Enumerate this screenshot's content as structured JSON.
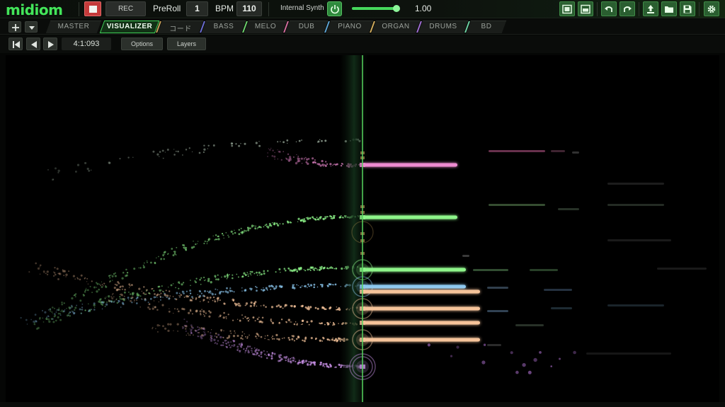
{
  "app": {
    "logo": "midiom"
  },
  "toolbar": {
    "rec_label": "REC",
    "preroll_label": "PreRoll",
    "preroll_value": "1",
    "bpm_label": "BPM",
    "bpm_value": "110",
    "synth_label": "Internal Synth",
    "volume_value": "1.00",
    "volume_level": 0.93
  },
  "tabs": [
    {
      "label": "MASTER",
      "color": "#2a2f2a",
      "active": false
    },
    {
      "label": "VISUALIZER",
      "color": "#3fd257",
      "active": true
    },
    {
      "label": "コード",
      "color": "#c9a35a",
      "active": false
    },
    {
      "label": "BASS",
      "color": "#6d6fd6",
      "active": false
    },
    {
      "label": "MELO",
      "color": "#6fd66f",
      "active": false
    },
    {
      "label": "DUB",
      "color": "#d66fa0",
      "active": false
    },
    {
      "label": "PIANO",
      "color": "#5fa6d6",
      "active": false
    },
    {
      "label": "ORGAN",
      "color": "#d6b05f",
      "active": false
    },
    {
      "label": "DRUMS",
      "color": "#a26fd6",
      "active": false
    },
    {
      "label": "BD",
      "color": "#6fd6a6",
      "active": false
    }
  ],
  "transport": {
    "position": "4:1:093",
    "options_label": "Options",
    "layers_label": "Layers"
  },
  "colors": {
    "accent": "#3fd257",
    "stop": "#c43a3a",
    "pink_note": "#f08bd2",
    "green_note": "#8ef58a",
    "blue_note": "#8cc8f0",
    "peach_note": "#f5c39a",
    "purple_note": "#c890e6"
  }
}
